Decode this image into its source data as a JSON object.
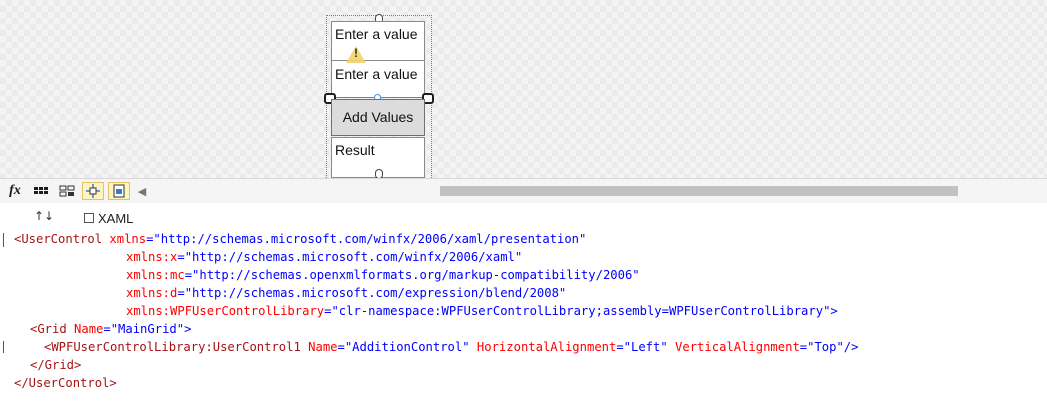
{
  "designer": {
    "textbox1_text": "Enter a value",
    "textbox2_text": "Enter a value",
    "button_label": "Add Values",
    "result_text": "Result"
  },
  "toolbar": {
    "fx_label": "fx",
    "scroll_left_glyph": "◀",
    "icons": [
      "fx-icon",
      "grid-icon",
      "grid-snap-icon",
      "snap-lines-icon",
      "artboard-icon",
      "scroll-left-icon"
    ]
  },
  "tabs": {
    "swap_glyph": "↑↓",
    "xaml_label": "XAML"
  },
  "code": {
    "line1": {
      "el": "<UserControl",
      "a1": " xmlns",
      "v1": "=\"http://schemas.microsoft.com/winfx/2006/xaml/presentation\""
    },
    "line2": {
      "a": "xmlns:x",
      "v": "=\"http://schemas.microsoft.com/winfx/2006/xaml\""
    },
    "line3": {
      "a": "xmlns:mc",
      "v": "=\"http://schemas.openxmlformats.org/markup-compatibility/2006\""
    },
    "line4": {
      "a": "xmlns:d",
      "v": "=\"http://schemas.microsoft.com/expression/blend/2008\""
    },
    "line5": {
      "a": "xmlns:WPFUserControlLibrary",
      "v": "=\"clr-namespace:WPFUserControlLibrary;assembly=WPFUserControlLibrary\">"
    },
    "line6": {
      "el": "<Grid",
      "a": " Name",
      "v": "=\"MainGrid\">"
    },
    "line7": {
      "el": "<WPFUserControlLibrary:UserControl1",
      "a1": " Name",
      "v1": "=\"AdditionControl\"",
      "a2": " HorizontalAlignment",
      "v2": "=\"Left\"",
      "a3": " VerticalAlignment",
      "v3": "=\"Top\"/>"
    },
    "line8": {
      "el": "</Grid>"
    },
    "line9": {
      "el": "</UserControl>"
    }
  }
}
